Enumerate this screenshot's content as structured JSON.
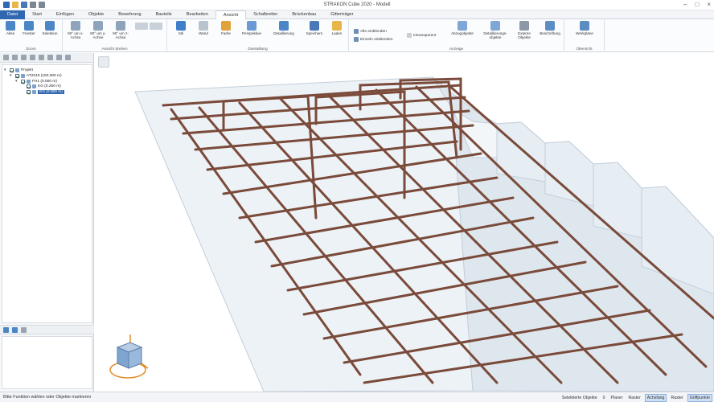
{
  "window": {
    "title": "STRAKON Cube 2020 - Modell"
  },
  "tabs": [
    "Datei",
    "Start",
    "Einfügen",
    "Objekte",
    "Bewehrung",
    "Bauteile",
    "Bearbeiten",
    "Ansicht",
    "Schalbretter",
    "Brückenbau",
    "Gitterträger"
  ],
  "active_tab": "Ansicht",
  "ribbon": {
    "zoom": {
      "label": "Zoom",
      "buttons": [
        "Alles",
        "Fenster",
        "Selektion"
      ]
    },
    "rotate": {
      "label": "Ansicht drehen",
      "buttons": [
        "90° um x-Achse",
        "90° um y-Achse",
        "90° um z-Achse"
      ]
    },
    "display": {
      "label": "Darstellung",
      "buttons": [
        "Stil",
        "Wand",
        "Farbe",
        "Perspektive",
        "Detaillierung",
        "Speichern",
        "Laden"
      ]
    },
    "show": {
      "label": "Anzeige",
      "small": [
        "Alle einblenden",
        "Einzeln einblenden"
      ],
      "buttons": [
        "Intransparent",
        "Abzugobjekte",
        "Detaillierungs-objekte",
        "Externe Objekte",
        "Beschriftung"
      ]
    },
    "overview": {
      "label": "Übersicht",
      "buttons": [
        "Werkpläne"
      ]
    }
  },
  "tree": [
    {
      "label": "Projekt",
      "indent": 0
    },
    {
      "label": "AT2019 (150.000 m)",
      "indent": 1
    },
    {
      "label": "FH1 (0.000 m)",
      "indent": 2
    },
    {
      "label": "KG (0.250 m)",
      "indent": 3
    },
    {
      "label": "EG (0.000 m)",
      "indent": 3,
      "selected": true
    }
  ],
  "status": {
    "message": "Bitte Funktion wählen oder Objekte markieren",
    "selected_label": "Selektierte Objekte",
    "selected_count": "0",
    "toggles": [
      {
        "label": "Planer",
        "on": false
      },
      {
        "label": "Raster",
        "on": false
      },
      {
        "label": "Achsfang",
        "on": true
      },
      {
        "label": "Raster",
        "on": false
      },
      {
        "label": "Griffpunkte",
        "on": true
      }
    ]
  },
  "colors": {
    "accent": "#2f67b1",
    "rebar": "#7a4a3a",
    "concrete": "#d9e2ea"
  }
}
